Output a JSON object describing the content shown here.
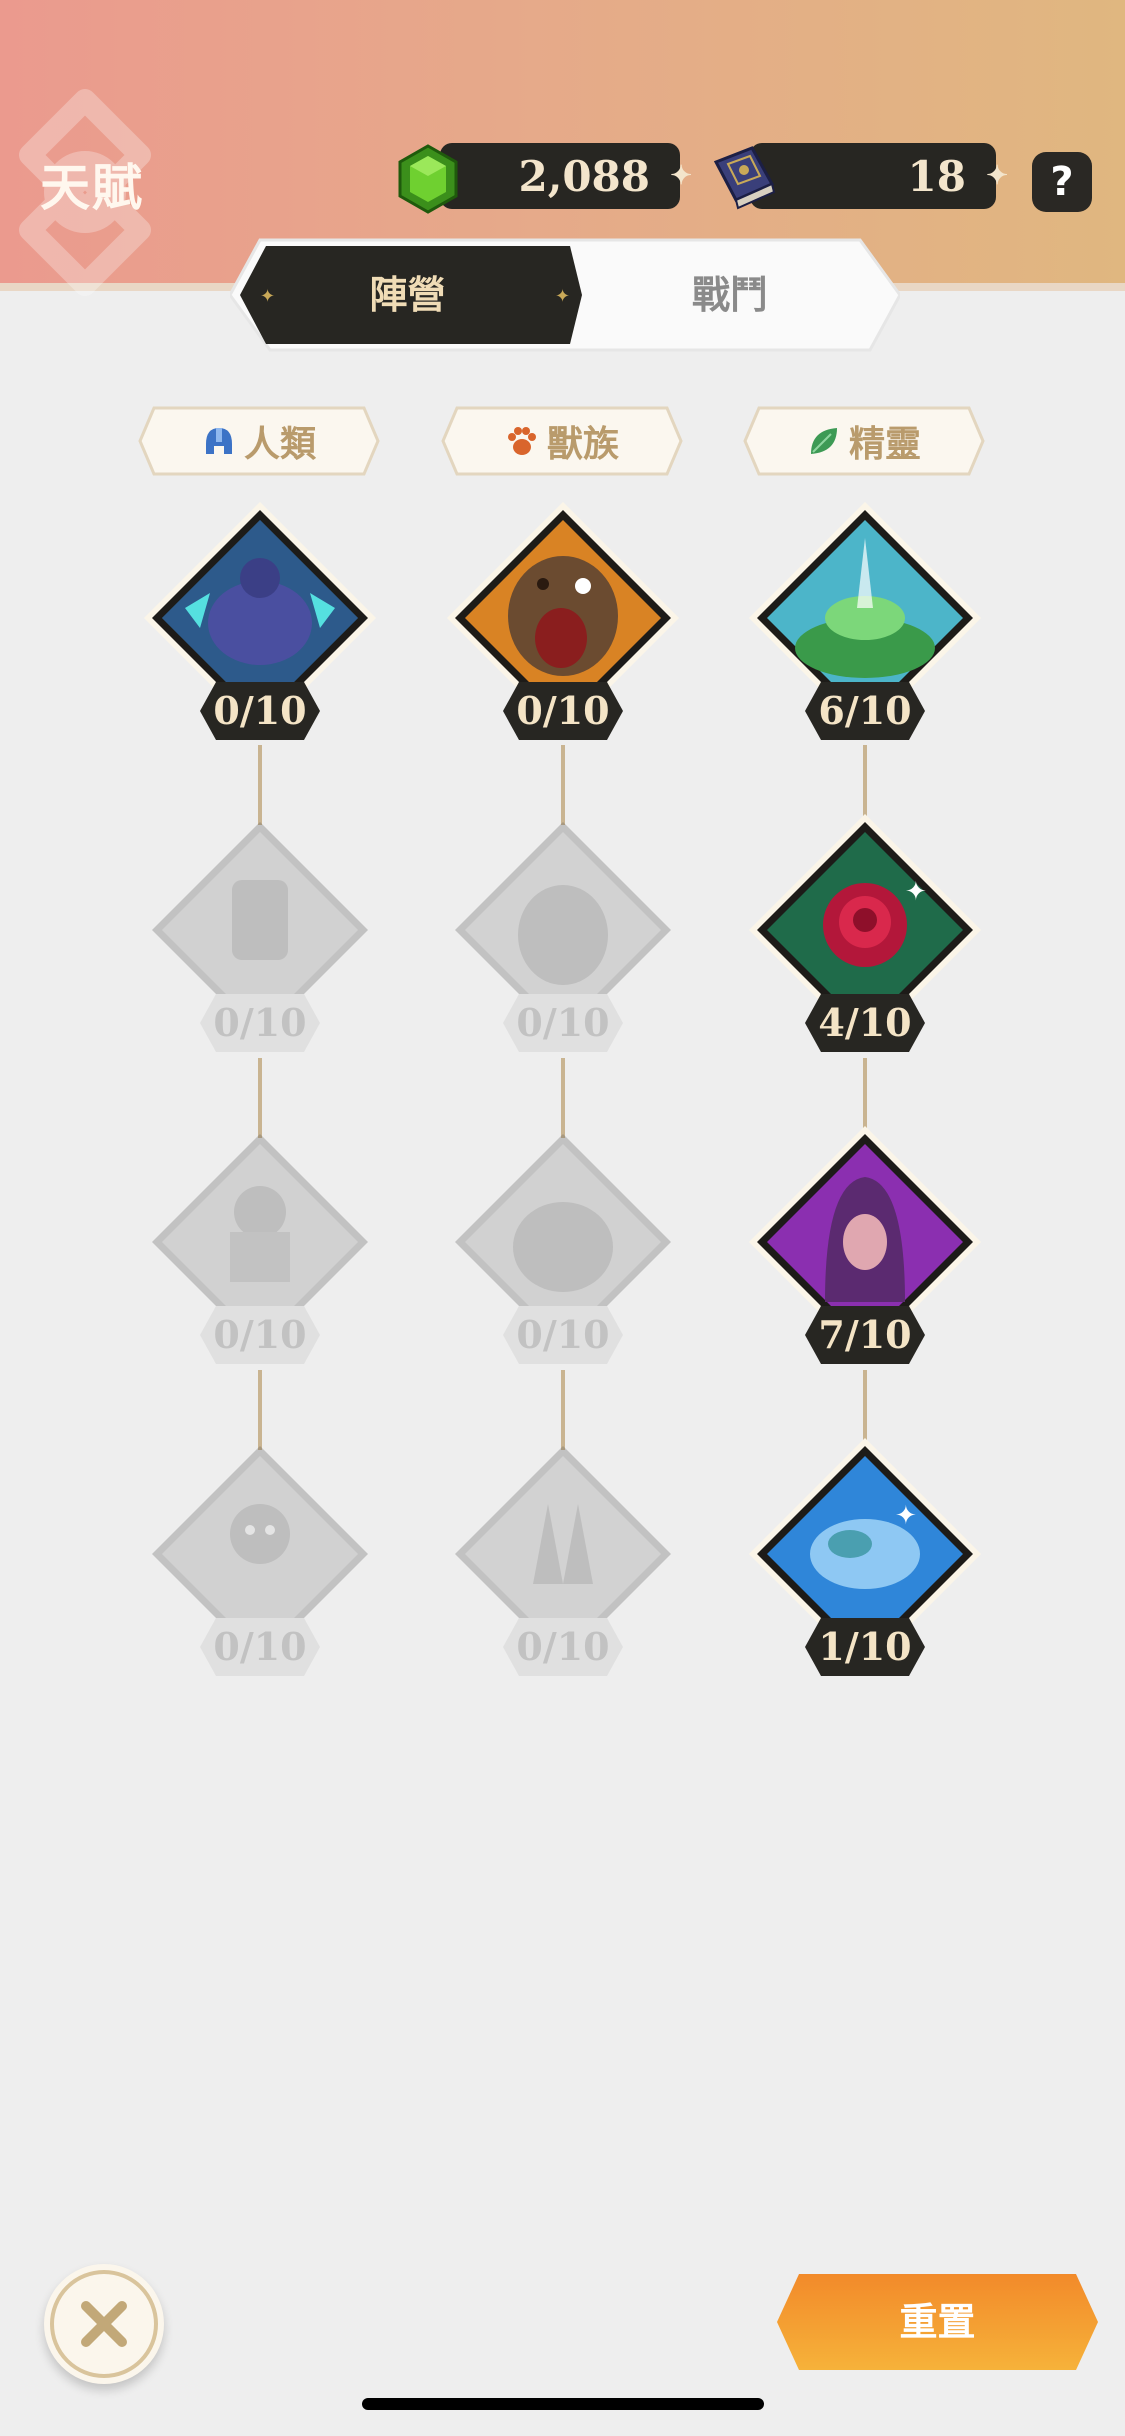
{
  "header": {
    "title": "天賦",
    "currencies": [
      {
        "name": "gem",
        "value": "2,088"
      },
      {
        "name": "tome",
        "value": "18"
      }
    ],
    "help_label": "?"
  },
  "tabs": [
    {
      "label": "陣營",
      "active": true
    },
    {
      "label": "戰鬥",
      "active": false
    }
  ],
  "factions": [
    {
      "label": "人類",
      "icon": "helmet-icon"
    },
    {
      "label": "獸族",
      "icon": "paw-icon"
    },
    {
      "label": "精靈",
      "icon": "leaf-icon"
    }
  ],
  "talents": {
    "human": [
      {
        "icon": "muscle-spirit-icon",
        "level": "0/10",
        "unlocked": true
      },
      {
        "icon": "armored-fist-icon",
        "level": "0/10",
        "unlocked": false
      },
      {
        "icon": "raised-fist-icon",
        "level": "0/10",
        "unlocked": false
      },
      {
        "icon": "berserker-icon",
        "level": "0/10",
        "unlocked": false
      }
    ],
    "beast": [
      {
        "icon": "roaring-bear-icon",
        "level": "0/10",
        "unlocked": true
      },
      {
        "icon": "lightning-beast-icon",
        "level": "0/10",
        "unlocked": false
      },
      {
        "icon": "stone-beast-icon",
        "level": "0/10",
        "unlocked": false
      },
      {
        "icon": "beast-claw-icon",
        "level": "0/10",
        "unlocked": false
      }
    ],
    "elf": [
      {
        "icon": "forest-glade-icon",
        "level": "6/10",
        "unlocked": true
      },
      {
        "icon": "rose-icon",
        "level": "4/10",
        "unlocked": true
      },
      {
        "icon": "hooded-sorceress-icon",
        "level": "7/10",
        "unlocked": true
      },
      {
        "icon": "water-hand-icon",
        "level": "1/10",
        "unlocked": true
      }
    ]
  },
  "footer": {
    "reset_label": "重置",
    "close_icon": "close-icon"
  },
  "colors": {
    "header_left": "#eb9a8e",
    "header_right": "#e0b780",
    "dark": "#272622",
    "gold_text": "#f0dcb6",
    "reset_orange": "#f39a2e"
  }
}
